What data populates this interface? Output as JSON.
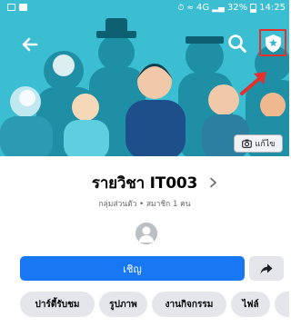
{
  "status_bar": {
    "battery": "32%",
    "time": "14:25",
    "network": "4G"
  },
  "icons": {
    "back": "arrow-left-icon",
    "search": "search-icon",
    "admin": "shield-star-icon",
    "camera": "camera-icon",
    "share": "share-arrow-icon"
  },
  "cover": {
    "edit_label": "แก้ไข"
  },
  "group": {
    "title": "รายวิชา IT003",
    "subtitle": "กลุ่มส่วนตัว • สมาชิก 1 คน"
  },
  "actions": {
    "invite_label": "เชิญ"
  },
  "tabs": [
    {
      "label": "ปาร์ตี้รับชม"
    },
    {
      "label": "รูปภาพ"
    },
    {
      "label": "งานกิจกรรม"
    },
    {
      "label": "ไฟล์"
    }
  ],
  "colors": {
    "cover_bg": "#35b7cd",
    "accent": "#1877f2",
    "highlight": "#e3312e"
  }
}
